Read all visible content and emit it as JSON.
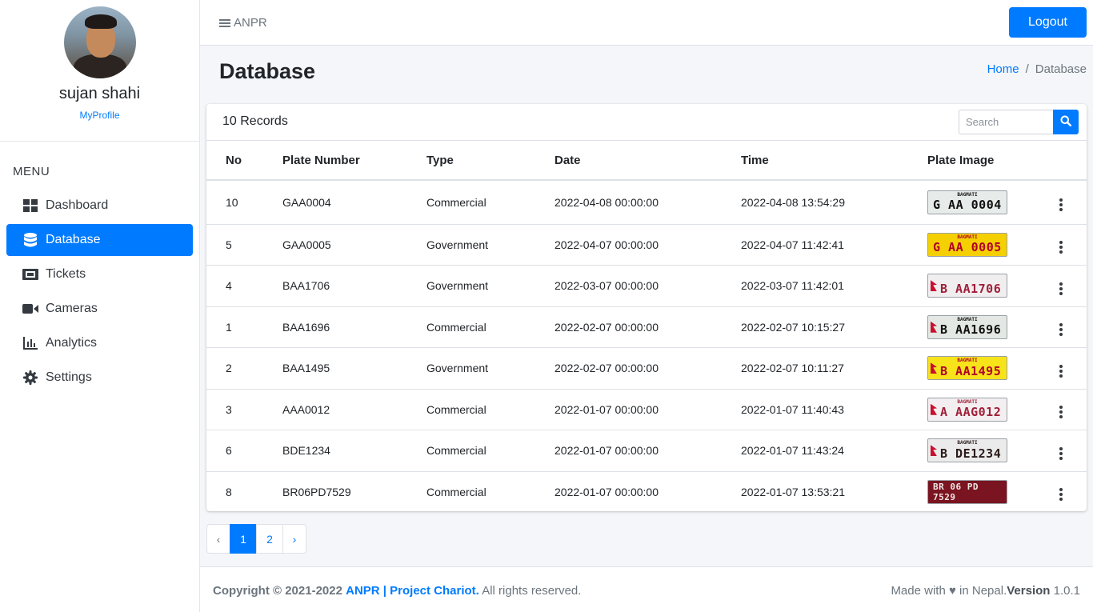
{
  "user": {
    "name": "sujan shahi",
    "profile_link": "MyProfile"
  },
  "sidebar": {
    "menu_title": "MENU",
    "items": [
      {
        "label": "Dashboard",
        "icon": "dashboard-icon"
      },
      {
        "label": "Database",
        "icon": "database-icon",
        "active": true
      },
      {
        "label": "Tickets",
        "icon": "ticket-icon"
      },
      {
        "label": "Cameras",
        "icon": "video-camera-icon"
      },
      {
        "label": "Analytics",
        "icon": "chart-bar-icon"
      },
      {
        "label": "Settings",
        "icon": "gear-icon"
      }
    ]
  },
  "topbar": {
    "brand": "ANPR",
    "logout_label": "Logout"
  },
  "page": {
    "title": "Database",
    "breadcrumb": {
      "home": "Home",
      "separator": "/",
      "current": "Database"
    }
  },
  "card": {
    "records_label": "10 Records",
    "search_placeholder": "Search"
  },
  "table": {
    "headers": {
      "no": "No",
      "plate": "Plate Number",
      "type": "Type",
      "date": "Date",
      "time": "Time",
      "image": "Plate Image"
    },
    "rows": [
      {
        "no": "10",
        "plate": "GAA0004",
        "type": "Commercial",
        "date": "2022-04-08 00:00:00",
        "time": "2022-04-08 13:54:29",
        "img_top": "BAGMATI",
        "img_text": "G AA 0004",
        "img_bg": "#e7ecea",
        "img_fg": "#111111",
        "img_flag": false
      },
      {
        "no": "5",
        "plate": "GAA0005",
        "type": "Government",
        "date": "2022-04-07 00:00:00",
        "time": "2022-04-07 11:42:41",
        "img_top": "BAGMATI",
        "img_text": "G AA 0005",
        "img_bg": "#f5d000",
        "img_fg": "#b0002a",
        "img_flag": false
      },
      {
        "no": "4",
        "plate": "BAA1706",
        "type": "Government",
        "date": "2022-03-07 00:00:00",
        "time": "2022-03-07 11:42:01",
        "img_top": "",
        "img_text": "B AA1706",
        "img_bg": "#f1eef0",
        "img_fg": "#a0203a",
        "img_flag": true
      },
      {
        "no": "1",
        "plate": "BAA1696",
        "type": "Commercial",
        "date": "2022-02-07 00:00:00",
        "time": "2022-02-07 10:15:27",
        "img_top": "BAGMATI",
        "img_text": "B AA1696",
        "img_bg": "#e3e8e4",
        "img_fg": "#111111",
        "img_flag": true
      },
      {
        "no": "2",
        "plate": "BAA1495",
        "type": "Government",
        "date": "2022-02-07 00:00:00",
        "time": "2022-02-07 10:11:27",
        "img_top": "BAGMATI",
        "img_text": "B AA1495",
        "img_bg": "#f7e31a",
        "img_fg": "#b0002a",
        "img_flag": true
      },
      {
        "no": "3",
        "plate": "AAA0012",
        "type": "Commercial",
        "date": "2022-01-07 00:00:00",
        "time": "2022-01-07 11:40:43",
        "img_top": "BAGMATI",
        "img_text": "A AAG012",
        "img_bg": "#f3eff0",
        "img_fg": "#a0203a",
        "img_flag": true
      },
      {
        "no": "6",
        "plate": "BDE1234",
        "type": "Commercial",
        "date": "2022-01-07 00:00:00",
        "time": "2022-01-07 11:43:24",
        "img_top": "BAGMATI",
        "img_text": "B DE1234",
        "img_bg": "#ecebeb",
        "img_fg": "#2a1a1a",
        "img_flag": true
      },
      {
        "no": "8",
        "plate": "BR06PD7529",
        "type": "Commercial",
        "date": "2022-01-07 00:00:00",
        "time": "2022-01-07 13:53:21",
        "img_top": "",
        "img_text": "BR 06 PD 7529",
        "img_bg": "#7a1420",
        "img_fg": "#1a1a1a",
        "img_flag": false
      }
    ]
  },
  "pagination": {
    "prev": "‹",
    "pages": [
      "1",
      "2"
    ],
    "current": "1",
    "next": "›"
  },
  "footer": {
    "copyright": "Copyright © 2021-2022",
    "brand_link": "ANPR | Project Chariot.",
    "rights": "All rights reserved.",
    "made_with": "Made with ♥ in Nepal.",
    "version_label": "Version",
    "version": "1.0.1"
  },
  "colors": {
    "primary": "#007bff",
    "text": "#212529",
    "muted": "#6c757d"
  }
}
